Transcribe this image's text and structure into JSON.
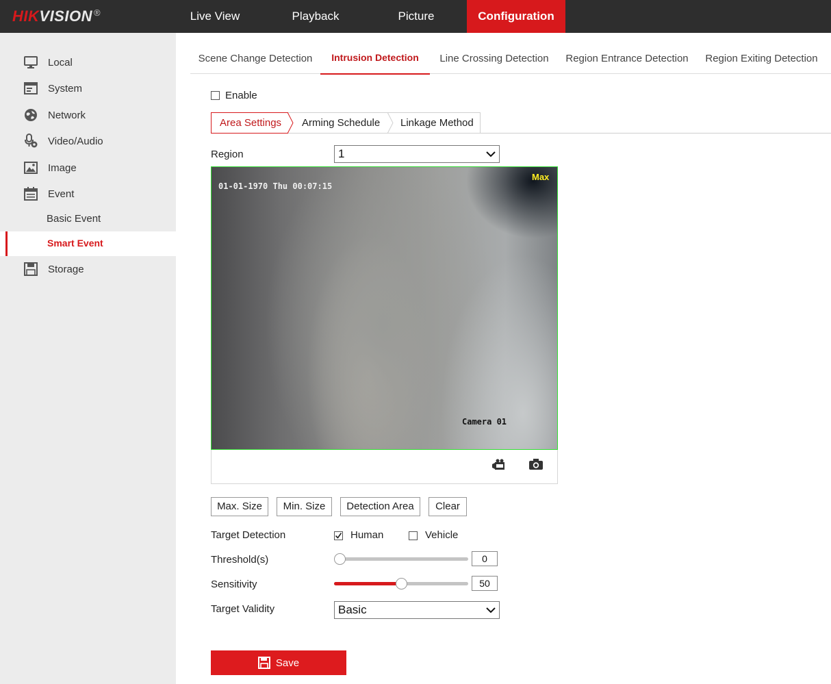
{
  "header": {
    "logo_text_red": "HIK",
    "logo_text_white": "VISION",
    "logo_reg": "®",
    "nav": [
      {
        "label": "Live View"
      },
      {
        "label": "Playback"
      },
      {
        "label": "Picture"
      },
      {
        "label": "Configuration",
        "active": true
      }
    ]
  },
  "sidebar": {
    "items": [
      {
        "label": "Local",
        "icon": "monitor-icon"
      },
      {
        "label": "System",
        "icon": "window-icon"
      },
      {
        "label": "Network",
        "icon": "globe-icon"
      },
      {
        "label": "Video/Audio",
        "icon": "microphone-icon"
      },
      {
        "label": "Image",
        "icon": "image-icon"
      },
      {
        "label": "Event",
        "icon": "calendar-icon"
      },
      {
        "label": "Storage",
        "icon": "floppy-icon"
      }
    ],
    "sub_items": [
      {
        "label": "Basic Event"
      },
      {
        "label": "Smart Event",
        "active": true
      }
    ]
  },
  "tabs": [
    {
      "label": "Scene Change Detection"
    },
    {
      "label": "Intrusion Detection",
      "active": true
    },
    {
      "label": "Line Crossing Detection"
    },
    {
      "label": "Region Entrance Detection"
    },
    {
      "label": "Region Exiting Detection"
    }
  ],
  "enable": {
    "label": "Enable",
    "checked": false
  },
  "subtabs": [
    {
      "label": "Area Settings",
      "active": true
    },
    {
      "label": "Arming Schedule"
    },
    {
      "label": "Linkage Method"
    }
  ],
  "region": {
    "label": "Region",
    "value": "1"
  },
  "video": {
    "osd_time": "01-01-1970 Thu 00:07:15",
    "osd_camera": "Camera 01",
    "overlay_label": "Max",
    "border_color": "#33dd33"
  },
  "buttons": {
    "max_size": "Max. Size",
    "min_size": "Min. Size",
    "detection_area": "Detection Area",
    "clear": "Clear"
  },
  "target_detection": {
    "label": "Target Detection",
    "human": {
      "label": "Human",
      "checked": true
    },
    "vehicle": {
      "label": "Vehicle",
      "checked": false
    }
  },
  "threshold": {
    "label": "Threshold(s)",
    "value": "0",
    "fraction": 0
  },
  "sensitivity": {
    "label": "Sensitivity",
    "value": "50",
    "fraction": 0.5
  },
  "target_validity": {
    "label": "Target Validity",
    "value": "Basic"
  },
  "save": {
    "label": "Save"
  },
  "colors": {
    "accent": "#d7191c",
    "header_bg": "#2e2e2e",
    "sidebar_bg": "#ececec"
  }
}
